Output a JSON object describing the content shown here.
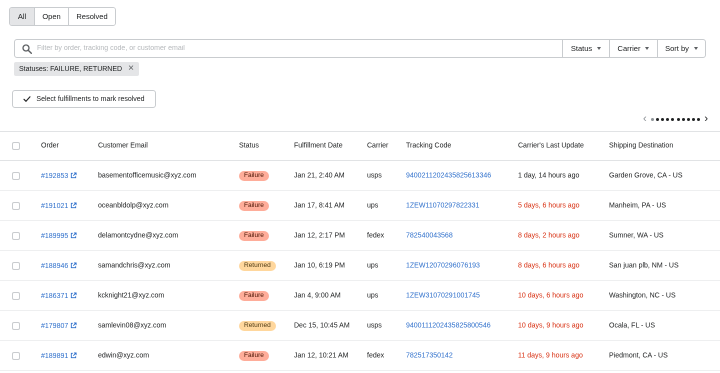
{
  "tabs": [
    {
      "label": "All",
      "active": true
    },
    {
      "label": "Open",
      "active": false
    },
    {
      "label": "Resolved",
      "active": false
    }
  ],
  "search": {
    "placeholder": "Filter by order, tracking code, or customer email",
    "value": ""
  },
  "filters": {
    "status_label": "Status",
    "carrier_label": "Carrier",
    "sort_label": "Sort by"
  },
  "applied_filter": {
    "label": "Statuses: FAILURE, RETURNED",
    "close": "×"
  },
  "mark_button": {
    "label": "Select fulfillments to mark resolved"
  },
  "pagination": {
    "prev": "‹",
    "next": "›"
  },
  "table": {
    "headers": {
      "order": "Order",
      "email": "Customer Email",
      "status": "Status",
      "date": "Fulfillment Date",
      "carrier": "Carrier",
      "tracking": "Tracking Code",
      "update": "Carrier's Last Update",
      "destination": "Shipping Destination"
    },
    "rows": [
      {
        "order": "#192853",
        "email": "basementofficemusic@xyz.com",
        "status": "Failure",
        "date": "Jan 21, 2:40 AM",
        "carrier": "usps",
        "tracking": "9400211202435825613346",
        "update": "1 day, 14 hours ago",
        "update_red": false,
        "destination": "Garden Grove, CA - US"
      },
      {
        "order": "#191021",
        "email": "oceanbldolp@xyz.com",
        "status": "Failure",
        "date": "Jan 17, 8:41 AM",
        "carrier": "ups",
        "tracking": "1ZEW11070297822331",
        "update": "5 days, 6 hours ago",
        "update_red": true,
        "destination": "Manheim, PA - US"
      },
      {
        "order": "#189995",
        "email": "delamontcydne@xyz.com",
        "status": "Failure",
        "date": "Jan 12, 2:17 PM",
        "carrier": "fedex",
        "tracking": "782540043568",
        "update": "8 days, 2 hours ago",
        "update_red": true,
        "destination": "Sumner, WA - US"
      },
      {
        "order": "#188946",
        "email": "samandchris@xyz.com",
        "status": "Returned",
        "date": "Jan 10, 6:19 PM",
        "carrier": "ups",
        "tracking": "1ZEW12070296076193",
        "update": "8 days, 6 hours ago",
        "update_red": true,
        "destination": "San juan plb, NM - US"
      },
      {
        "order": "#186371",
        "email": "kcknight21@xyz.com",
        "status": "Failure",
        "date": "Jan 4, 9:00 AM",
        "carrier": "ups",
        "tracking": "1ZEW31070291001745",
        "update": "10 days, 6 hours ago",
        "update_red": true,
        "destination": "Washington, NC - US"
      },
      {
        "order": "#179807",
        "email": "samlevin08@xyz.com",
        "status": "Returned",
        "date": "Dec 15, 10:45 AM",
        "carrier": "usps",
        "tracking": "9400111202435825800546",
        "update": "10 days, 9 hours ago",
        "update_red": true,
        "destination": "Ocala, FL - US"
      },
      {
        "order": "#189891",
        "email": "edwin@xyz.com",
        "status": "Failure",
        "date": "Jan 12, 10:21 AM",
        "carrier": "fedex",
        "tracking": "782517350142",
        "update": "11 days, 9 hours ago",
        "update_red": true,
        "destination": "Piedmont, CA - US"
      }
    ]
  },
  "colors": {
    "link": "#2c6ecb",
    "failure_badge": "#fead9a",
    "returned_badge": "#ffd79d",
    "overdue_text": "#d72c0d"
  },
  "icons": {
    "search": "search-icon",
    "external": "external-link-icon",
    "check": "check-icon",
    "close": "close-icon",
    "caret": "chevron-down-icon"
  }
}
